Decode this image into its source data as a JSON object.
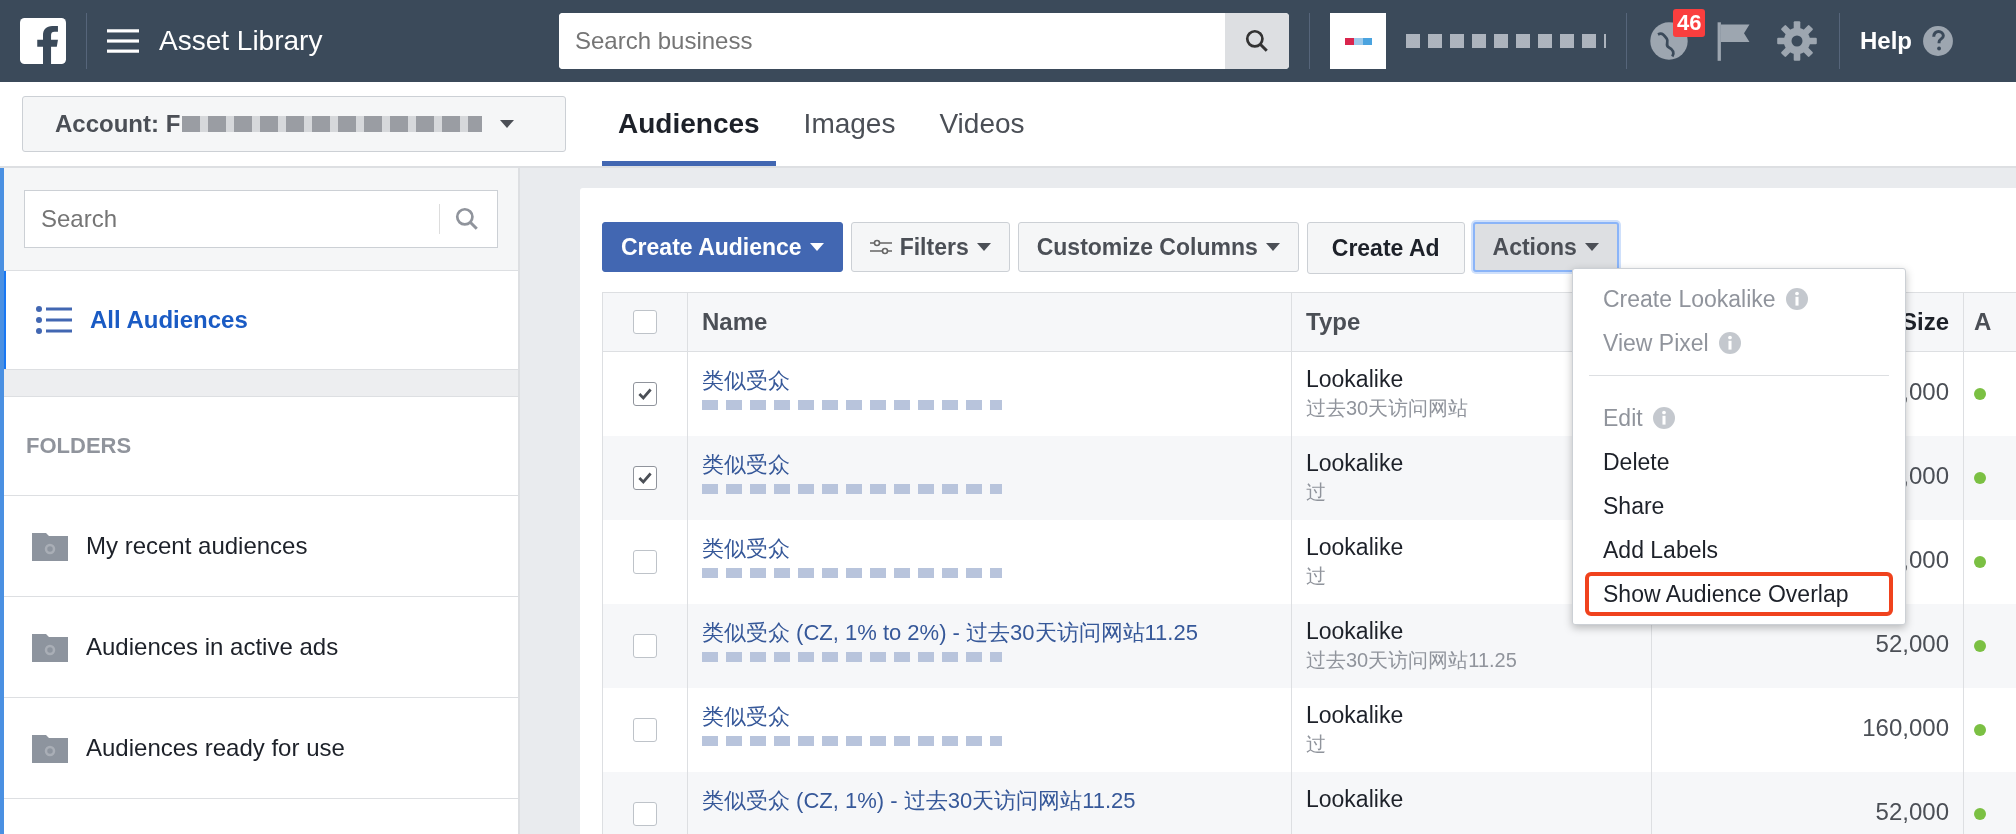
{
  "top_bar": {
    "title": "Asset Library",
    "search": {
      "placeholder": "Search business"
    },
    "notification_count": "46",
    "help": "Help"
  },
  "account": {
    "label": "Account: F"
  },
  "tabs": [
    {
      "label": "Audiences",
      "selected": true
    },
    {
      "label": "Images",
      "selected": false
    },
    {
      "label": "Videos",
      "selected": false
    }
  ],
  "sidebar": {
    "search": {
      "placeholder": "Search"
    },
    "all_item": {
      "label": "All Audiences",
      "selected": true
    },
    "folders_heading": "FOLDERS",
    "folders": [
      {
        "label": "My recent audiences"
      },
      {
        "label": "Audiences in active ads"
      },
      {
        "label": "Audiences ready for use"
      }
    ]
  },
  "toolbar": [
    {
      "label": "Create Audience",
      "kind": "primary"
    },
    {
      "label": "Filters",
      "kind": "filter"
    },
    {
      "label": "Customize Columns",
      "kind": "dropdown"
    },
    {
      "label": "Create Ad",
      "kind": "plain"
    },
    {
      "label": "Actions",
      "kind": "active"
    }
  ],
  "table": {
    "select_all": {
      "checked": false
    },
    "columns": [
      "Name",
      "Type",
      "Size",
      "A"
    ],
    "rows": [
      {
        "selected": true,
        "name": "类似受众",
        "type": "Lookalike",
        "source": "过去30天访问网站",
        "size": ",000",
        "color": "#7bc043"
      },
      {
        "selected": true,
        "name": "类似受众",
        "type": "Lookalike",
        "source": "过",
        "size": ",000",
        "color": "#7bc043"
      },
      {
        "selected": false,
        "name": "类似受众",
        "type": "Lookalike",
        "source": "过",
        "size": ",000",
        "color": "#7bc043"
      },
      {
        "selected": false,
        "name": "类似受众 (CZ, 1% to 2%) - 过去30天访问网站11.25",
        "type": "Lookalike",
        "source": "过去30天访问网站11.25",
        "size": "52,000",
        "color": "#7bc043"
      },
      {
        "selected": false,
        "name": "类似受众",
        "type": "Lookalike",
        "source": "过",
        "size": "160,000",
        "color": "#7bc043"
      },
      {
        "selected": false,
        "name": "类似受众 (CZ, 1%) - 过去30天访问网站11.25",
        "type": "Lookalike",
        "source": "",
        "size": "52,000",
        "color": "#7bc043"
      }
    ]
  },
  "actions_menu": [
    {
      "kind": "item",
      "label": "Create Lookalike",
      "disabled": true,
      "info": true,
      "highlighted": false
    },
    {
      "kind": "item",
      "label": "View Pixel",
      "disabled": true,
      "info": true,
      "highlighted": false
    },
    {
      "kind": "separator"
    },
    {
      "kind": "item",
      "label": "Edit",
      "disabled": true,
      "info": true,
      "highlighted": false
    },
    {
      "kind": "item",
      "label": "Delete",
      "disabled": false,
      "info": false,
      "highlighted": false
    },
    {
      "kind": "item",
      "label": "Share",
      "disabled": false,
      "info": false,
      "highlighted": false
    },
    {
      "kind": "item",
      "label": "Add Labels",
      "disabled": false,
      "info": false,
      "highlighted": false
    },
    {
      "kind": "item",
      "label": "Show Audience Overlap",
      "disabled": false,
      "info": false,
      "highlighted": true
    }
  ]
}
